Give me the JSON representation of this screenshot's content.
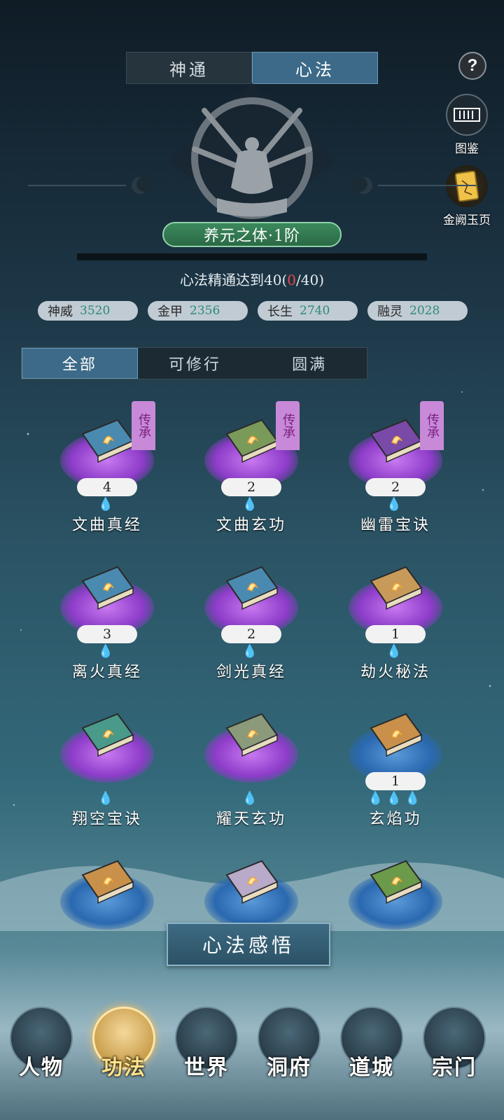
{
  "top_tabs": [
    {
      "label": "神通",
      "active": false
    },
    {
      "label": "心法",
      "active": true
    }
  ],
  "help_label": "?",
  "side_buttons": [
    {
      "label": "图鉴",
      "icon": "catalog-icon"
    },
    {
      "label": "金阙玉页",
      "icon": "golden-page-icon"
    }
  ],
  "rank": {
    "title": "养元之体·1阶"
  },
  "mastery": {
    "prefix": "心法精通达到40(",
    "current": "0",
    "suffix": "/40)"
  },
  "stats": [
    {
      "label": "神威",
      "value": "3520"
    },
    {
      "label": "金甲",
      "value": "2356"
    },
    {
      "label": "长生",
      "value": "2740"
    },
    {
      "label": "融灵",
      "value": "2028"
    }
  ],
  "filter_tabs": [
    {
      "label": "全部",
      "active": true
    },
    {
      "label": "可修行",
      "active": false
    },
    {
      "label": "圆满",
      "active": false
    }
  ],
  "skills": [
    {
      "name": "文曲真经",
      "count": "4",
      "tag": "传承",
      "drops": "💧",
      "glow": "purple",
      "book_color": "#4a8ab0"
    },
    {
      "name": "文曲玄功",
      "count": "2",
      "tag": "传承",
      "drops": "💧",
      "glow": "purple",
      "book_color": "#7a9a5a"
    },
    {
      "name": "幽雷宝诀",
      "count": "2",
      "tag": "传承",
      "drops": "💧",
      "glow": "purple",
      "book_color": "#7a4aa8"
    },
    {
      "name": "离火真经",
      "count": "3",
      "tag": "",
      "drops": "💧",
      "glow": "purple",
      "book_color": "#4a8ab0"
    },
    {
      "name": "剑光真经",
      "count": "2",
      "tag": "",
      "drops": "💧",
      "glow": "purple",
      "book_color": "#4a8ab0"
    },
    {
      "name": "劫火秘法",
      "count": "1",
      "tag": "",
      "drops": "💧",
      "glow": "purple",
      "book_color": "#c89a5a"
    },
    {
      "name": "翔空宝诀",
      "count": "",
      "tag": "",
      "drops": "💧",
      "glow": "purple",
      "book_color": "#4a9a8a"
    },
    {
      "name": "耀天玄功",
      "count": "",
      "tag": "",
      "drops": "💧",
      "glow": "purple",
      "book_color": "#8a9a7a"
    },
    {
      "name": "玄焰功",
      "count": "1",
      "tag": "",
      "drops": "💧💧💧",
      "glow": "blue",
      "book_color": "#c8904a"
    },
    {
      "name": "",
      "count": "",
      "tag": "",
      "drops": "",
      "glow": "blue",
      "book_color": "#c8904a"
    },
    {
      "name": "",
      "count": "",
      "tag": "",
      "drops": "",
      "glow": "blue",
      "book_color": "#b8aac8"
    },
    {
      "name": "",
      "count": "",
      "tag": "",
      "drops": "",
      "glow": "blue",
      "book_color": "#6a9a4a"
    }
  ],
  "comprehend_button": "心法感悟",
  "bottom_nav": [
    {
      "label": "人物",
      "active": false
    },
    {
      "label": "功法",
      "active": true
    },
    {
      "label": "世界",
      "active": false
    },
    {
      "label": "洞府",
      "active": false
    },
    {
      "label": "道城",
      "active": false
    },
    {
      "label": "宗门",
      "active": false
    }
  ],
  "colors": {
    "accent_tab": "#3c6a88",
    "rank_bar": "#3c8a5e",
    "stat_value": "#2e8a70",
    "purple_glow": "#8c3cc8",
    "blue_glow": "#2a68b0",
    "nav_active": "#ffe28a"
  }
}
